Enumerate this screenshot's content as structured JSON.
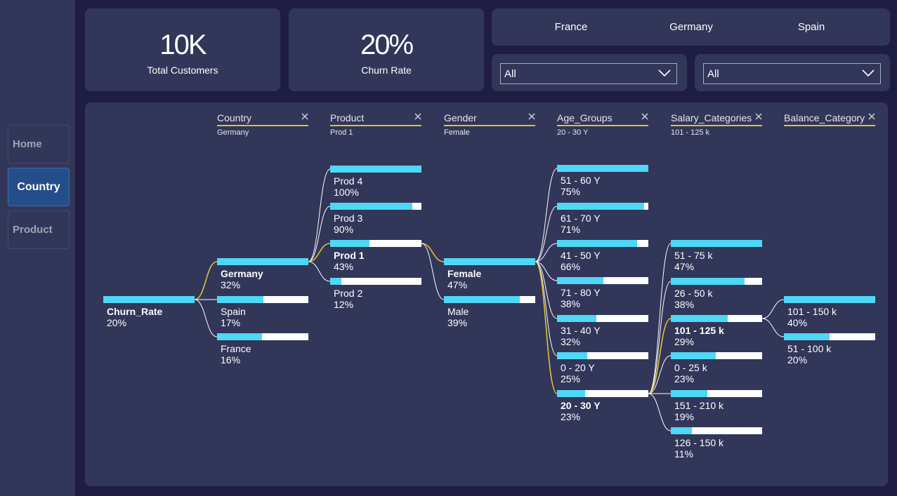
{
  "nav": {
    "items": [
      {
        "label": "Home",
        "active": false
      },
      {
        "label": "Country",
        "active": true
      },
      {
        "label": "Product",
        "active": false
      }
    ]
  },
  "kpis": {
    "total_customers": {
      "value": "10K",
      "label": "Total Customers"
    },
    "churn_rate": {
      "value": "20%",
      "label": "Churn Rate"
    }
  },
  "country_slicer": {
    "options": [
      "France",
      "Germany",
      "Spain"
    ]
  },
  "dropdowns": [
    {
      "value": "All"
    },
    {
      "value": "All"
    }
  ],
  "colors": {
    "accent_fill": "#4ed8f5",
    "selected_path": "#e1c233",
    "background": "#201d42",
    "card": "#323659",
    "nav_active": "#244e8a"
  },
  "decomposition_tree": {
    "levels": [
      {
        "field": "Country",
        "selected": "Germany"
      },
      {
        "field": "Product",
        "selected": "Prod 1"
      },
      {
        "field": "Gender",
        "selected": "Female"
      },
      {
        "field": "Age_Groups",
        "selected": "20 - 30 Y"
      },
      {
        "field": "Salary_Categories",
        "selected": "101 - 125 k"
      },
      {
        "field": "Balance_Category",
        "selected": ""
      }
    ],
    "root": {
      "label": "Churn_Rate",
      "value": "20%",
      "fraction": 1.0
    },
    "columns": [
      [
        {
          "label": "Germany",
          "value": "32%",
          "fraction": 1.0,
          "selected": true
        },
        {
          "label": "Spain",
          "value": "17%",
          "fraction": 0.51,
          "selected": false
        },
        {
          "label": "France",
          "value": "16%",
          "fraction": 0.49,
          "selected": false
        }
      ],
      [
        {
          "label": "Prod 4",
          "value": "100%",
          "fraction": 1.0,
          "selected": false
        },
        {
          "label": "Prod 3",
          "value": "90%",
          "fraction": 0.9,
          "selected": false
        },
        {
          "label": "Prod 1",
          "value": "43%",
          "fraction": 0.43,
          "selected": true
        },
        {
          "label": "Prod 2",
          "value": "12%",
          "fraction": 0.12,
          "selected": false
        }
      ],
      [
        {
          "label": "Female",
          "value": "47%",
          "fraction": 1.0,
          "selected": true
        },
        {
          "label": "Male",
          "value": "39%",
          "fraction": 0.83,
          "selected": false
        }
      ],
      [
        {
          "label": "51 - 60 Y",
          "value": "75%",
          "fraction": 1.0,
          "selected": false
        },
        {
          "label": "61 - 70 Y",
          "value": "71%",
          "fraction": 0.95,
          "selected": false
        },
        {
          "label": "41 - 50 Y",
          "value": "66%",
          "fraction": 0.88,
          "selected": false
        },
        {
          "label": "71 - 80 Y",
          "value": "38%",
          "fraction": 0.51,
          "selected": false
        },
        {
          "label": "31 - 40 Y",
          "value": "32%",
          "fraction": 0.43,
          "selected": false
        },
        {
          "label": "0 - 20 Y",
          "value": "25%",
          "fraction": 0.33,
          "selected": false
        },
        {
          "label": "20 - 30 Y",
          "value": "23%",
          "fraction": 0.31,
          "selected": true
        }
      ],
      [
        {
          "label": "51 - 75 k",
          "value": "47%",
          "fraction": 1.0,
          "selected": false
        },
        {
          "label": "26 - 50 k",
          "value": "38%",
          "fraction": 0.81,
          "selected": false
        },
        {
          "label": "101 - 125 k",
          "value": "29%",
          "fraction": 0.62,
          "selected": true
        },
        {
          "label": "0 - 25 k",
          "value": "23%",
          "fraction": 0.49,
          "selected": false
        },
        {
          "label": "151 - 210 k",
          "value": "19%",
          "fraction": 0.4,
          "selected": false
        },
        {
          "label": "126 - 150 k",
          "value": "11%",
          "fraction": 0.23,
          "selected": false
        }
      ],
      [
        {
          "label": "101 - 150 k",
          "value": "40%",
          "fraction": 1.0,
          "selected": false
        },
        {
          "label": "51 - 100 k",
          "value": "20%",
          "fraction": 0.5,
          "selected": false
        }
      ]
    ]
  }
}
